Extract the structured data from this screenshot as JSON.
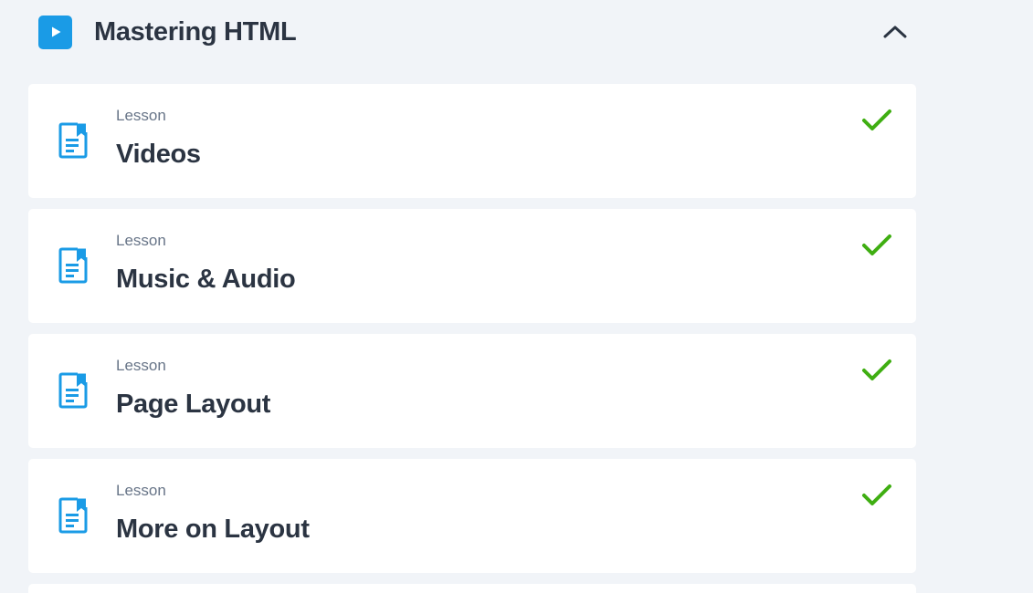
{
  "section": {
    "title": "Mastering HTML",
    "play_icon": "play-icon",
    "toggle_icon": "chevron-up-icon"
  },
  "colors": {
    "accent": "#1a9be6",
    "complete": "#3fae12",
    "text": "#2b3442",
    "muted": "#687588",
    "background": "#f1f4f8",
    "card": "#ffffff"
  },
  "lessons": [
    {
      "type": "Lesson",
      "title": "Videos",
      "icon": "document-icon",
      "status_icon": "checkmark-icon"
    },
    {
      "type": "Lesson",
      "title": "Music & Audio",
      "icon": "document-icon",
      "status_icon": "checkmark-icon"
    },
    {
      "type": "Lesson",
      "title": "Page Layout",
      "icon": "document-icon",
      "status_icon": "checkmark-icon"
    },
    {
      "type": "Lesson",
      "title": "More on Layout",
      "icon": "document-icon",
      "status_icon": "checkmark-icon"
    }
  ]
}
